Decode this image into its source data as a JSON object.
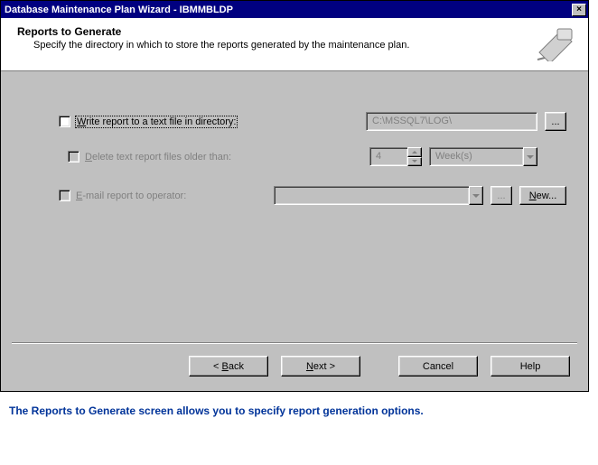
{
  "window": {
    "title": "Database Maintenance Plan Wizard - IBMMBLDP"
  },
  "header": {
    "title": "Reports to Generate",
    "subtitle": "Specify the directory in which to store the reports generated by the maintenance plan."
  },
  "form": {
    "write_report": {
      "label_pre": "W",
      "label_rest": "rite report to a text file in directory:",
      "path": "C:\\MSSQL7\\LOG\\",
      "browse": "..."
    },
    "delete_older": {
      "label_pre": "D",
      "label_rest": "elete text report files older than:",
      "value": "4",
      "unit": "Week(s)"
    },
    "email": {
      "label_pre": "E",
      "label_rest": "-mail report to operator:",
      "value": "",
      "browse": "...",
      "new": "New..."
    }
  },
  "buttons": {
    "back": "< Back",
    "next": "Next >",
    "cancel": "Cancel",
    "help": "Help"
  },
  "caption": "The Reports to Generate screen allows you to specify report generation options."
}
